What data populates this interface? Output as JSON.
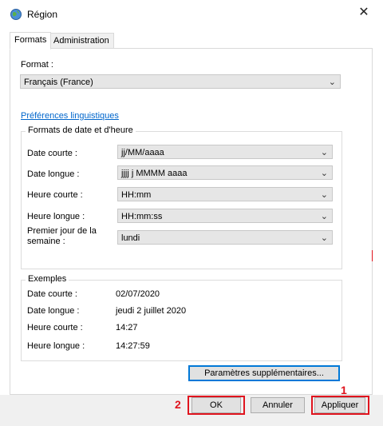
{
  "window": {
    "title": "Région",
    "close_symbol": "✕"
  },
  "tabs": [
    {
      "label": "Formats",
      "active": true
    },
    {
      "label": "Administration",
      "active": false
    }
  ],
  "format": {
    "label": "Format :",
    "value": "Français (France)"
  },
  "link": {
    "label": "Préférences linguistiques"
  },
  "date_formats": {
    "legend": "Formats de date et d'heure",
    "rows": [
      {
        "label": "Date courte :",
        "value": "jj/MM/aaaa"
      },
      {
        "label": "Date longue :",
        "value": "jjjj j MMMM aaaa"
      },
      {
        "label": "Heure courte :",
        "value": "HH:mm"
      },
      {
        "label": "Heure longue :",
        "value": "HH:mm:ss"
      },
      {
        "label_line1": "Premier jour de la",
        "label_line2": "semaine :",
        "value": "lundi"
      }
    ]
  },
  "examples": {
    "legend": "Exemples",
    "rows": [
      {
        "label": "Date courte :",
        "value": "02/07/2020"
      },
      {
        "label": "Date longue :",
        "value": "jeudi 2 juillet 2020"
      },
      {
        "label": "Heure courte :",
        "value": "14:27"
      },
      {
        "label": "Heure longue :",
        "value": "14:27:59"
      }
    ]
  },
  "buttons": {
    "extra": "Paramètres supplémentaires...",
    "ok": "OK",
    "cancel": "Annuler",
    "apply": "Appliquer"
  },
  "annotations": {
    "apply_number": "1",
    "ok_number": "2",
    "color": "#e0141e"
  },
  "icons": {
    "title": "globe-clock-icon",
    "chevron": "chevron-down-icon"
  }
}
